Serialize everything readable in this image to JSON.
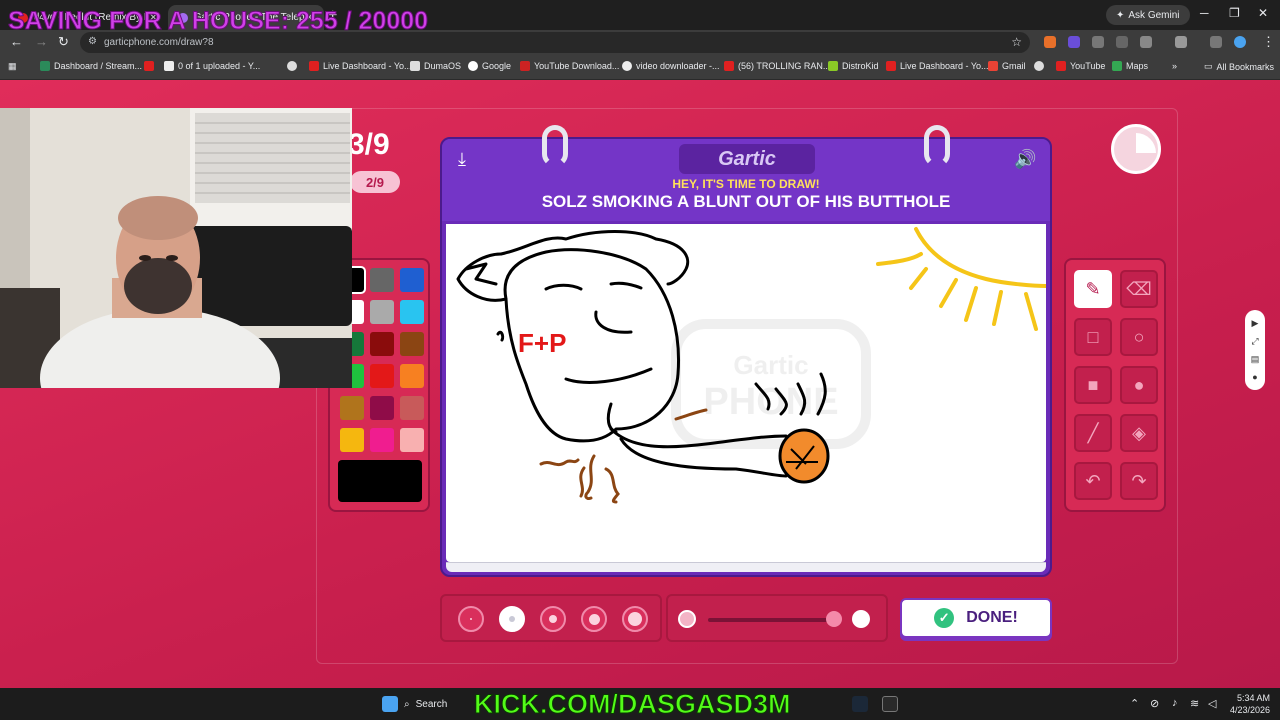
{
  "overlay": {
    "goal_text": "SAVING FOR A HOUSE: 255 / 20000"
  },
  "browser": {
    "tabs": [
      {
        "title": "d4vd - Feel It (Remix By L...",
        "active": false
      },
      {
        "title": "Gartic Phone - The Telephone G...",
        "active": true
      }
    ],
    "gemini_label": "Ask Gemini",
    "url": "garticphone.com/draw?8",
    "bookmarks": [
      "Dashboard / Stream...",
      "0 of 1 uploaded - Y...",
      "Live Dashboard - Yo...",
      "DumaOS",
      "Google",
      "YouTube Download...",
      "video downloader -...",
      "(56) TROLLING RAN...",
      "DistroKid",
      "Live Dashboard - Yo...",
      "Gmail",
      "YouTube",
      "Maps"
    ],
    "all_bookmarks": "All Bookmarks"
  },
  "game": {
    "round": "3/9",
    "round_pill": "2/9",
    "logo": "Gartic",
    "watermark_top": "Gartic",
    "watermark_bottom": "PHONE",
    "hey_text": "HEY, IT'S TIME TO DRAW!",
    "prompt": "SOLZ SMOKING A BLUNT OUT OF HIS BUTTHOLE",
    "drawing_text": "F+P",
    "done_label": "DONE!",
    "palette_colors": [
      "#000000",
      "#666666",
      "#1f5fd1",
      "#ffffff",
      "#aaaaaa",
      "#29c4f0",
      "#16783a",
      "#8a0c0c",
      "#8b4513",
      "#1fc23e",
      "#e31818",
      "#f78021",
      "#b0741c",
      "#8f0c48",
      "#c85a5a",
      "#f5b70f",
      "#f01d8f",
      "#f8b0b0"
    ],
    "current_color": "#000000",
    "tools": [
      "pencil-icon",
      "eraser-icon",
      "rectangle-outline-icon",
      "circle-outline-icon",
      "rectangle-filled-icon",
      "circle-filled-icon",
      "line-icon",
      "bucket-icon",
      "undo-icon",
      "redo-icon"
    ],
    "brush_size_selected": 2
  },
  "taskbar": {
    "search_label": "Search",
    "kick_text": "KICK.COM/DASGASD3M",
    "time": "5:34 AM",
    "date": "4/23/2026"
  }
}
